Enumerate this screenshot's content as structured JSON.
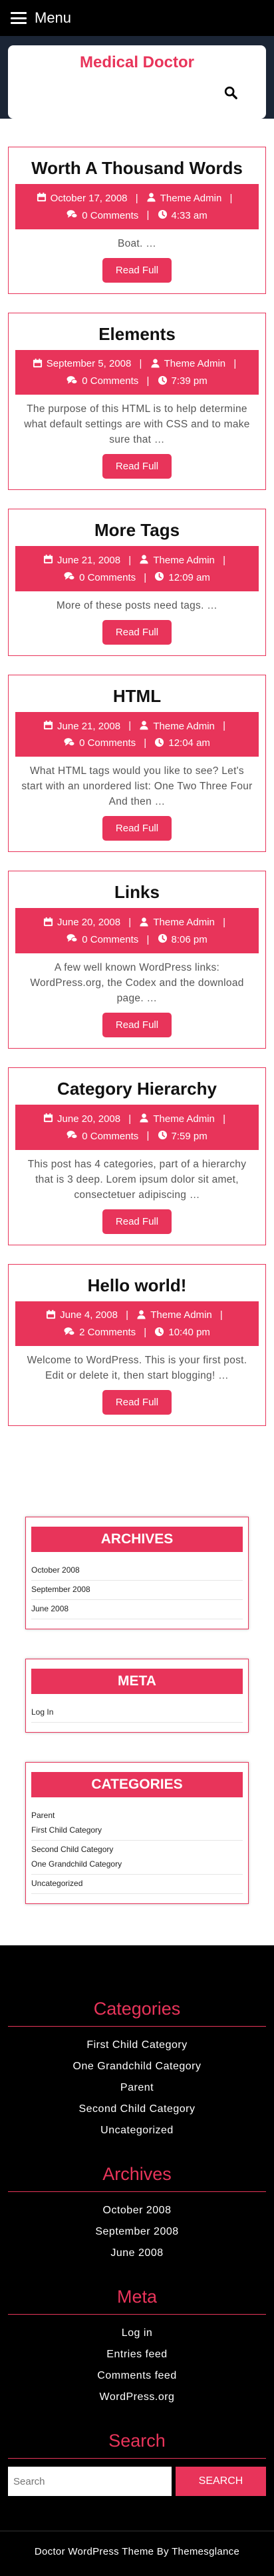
{
  "header": {
    "menu_label": "Menu",
    "site_title": "Medical Doctor"
  },
  "posts": [
    {
      "title": "Worth A Thousand Words",
      "date": "October 17, 2008",
      "author": "Theme Admin",
      "comments": "0 Comments",
      "time": "4:33 am",
      "excerpt": "Boat. …",
      "read_more": "Read Full"
    },
    {
      "title": "Elements",
      "date": "September 5, 2008",
      "author": "Theme Admin",
      "comments": "0 Comments",
      "time": "7:39 pm",
      "excerpt": "The purpose of this HTML is to help determine what default settings are with CSS and to make sure that …",
      "read_more": "Read Full"
    },
    {
      "title": "More Tags",
      "date": "June 21, 2008",
      "author": "Theme Admin",
      "comments": "0 Comments",
      "time": "12:09 am",
      "excerpt": "More of these posts need tags. …",
      "read_more": "Read Full"
    },
    {
      "title": "HTML",
      "date": "June 21, 2008",
      "author": "Theme Admin",
      "comments": "0 Comments",
      "time": "12:04 am",
      "excerpt": "What HTML tags would you like to see? Let's start with an unordered list: One Two Three Four And then …",
      "read_more": "Read Full"
    },
    {
      "title": "Links",
      "date": "June 20, 2008",
      "author": "Theme Admin",
      "comments": "0 Comments",
      "time": "8:06 pm",
      "excerpt": "A few well known WordPress links: WordPress.org, the Codex and the download page. …",
      "read_more": "Read Full"
    },
    {
      "title": "Category Hierarchy",
      "date": "June 20, 2008",
      "author": "Theme Admin",
      "comments": "0 Comments",
      "time": "7:59 pm",
      "excerpt": "This post has 4 categories, part of a hierarchy that is 3 deep. Lorem ipsum dolor sit amet, consectetuer adipiscing …",
      "read_more": "Read Full"
    },
    {
      "title": "Hello world!",
      "date": "June 4, 2008",
      "author": "Theme Admin",
      "comments": "2 Comments",
      "time": "10:40 pm",
      "excerpt": "Welcome to WordPress. This is your first post. Edit or delete it, then start blogging! …",
      "read_more": "Read Full"
    }
  ],
  "sidebar": {
    "archives": {
      "title": "ARCHIVES",
      "items": [
        "October 2008",
        "September 2008",
        "June 2008"
      ]
    },
    "meta": {
      "title": "META",
      "items": [
        "Log In"
      ]
    },
    "categories": {
      "title": "CATEGORIES",
      "items": [
        {
          "label": "Parent",
          "child": true
        },
        {
          "label": "First Child Category",
          "child": false
        },
        {
          "label": "Second Child Category",
          "child": true
        },
        {
          "label": "One Grandchild Category",
          "child": false
        },
        {
          "label": "Uncategorized",
          "child": false
        }
      ]
    }
  },
  "footer": {
    "categories": {
      "title": "Categories",
      "items": [
        "First Child Category",
        "One Grandchild Category",
        "Parent",
        "Second Child Category",
        "Uncategorized"
      ]
    },
    "archives": {
      "title": "Archives",
      "items": [
        "October 2008",
        "September 2008",
        "June 2008"
      ]
    },
    "meta": {
      "title": "Meta",
      "items": [
        "Log in",
        "Entries feed",
        "Comments feed",
        "WordPress.org"
      ]
    },
    "search": {
      "title": "Search",
      "placeholder": "Search",
      "button": "SEARCH"
    },
    "credit": "Doctor WordPress Theme By Themesglance"
  },
  "colors": {
    "accent": "#e8345a",
    "hero_bg": "#1b2535",
    "topbar_bg": "#000000"
  }
}
